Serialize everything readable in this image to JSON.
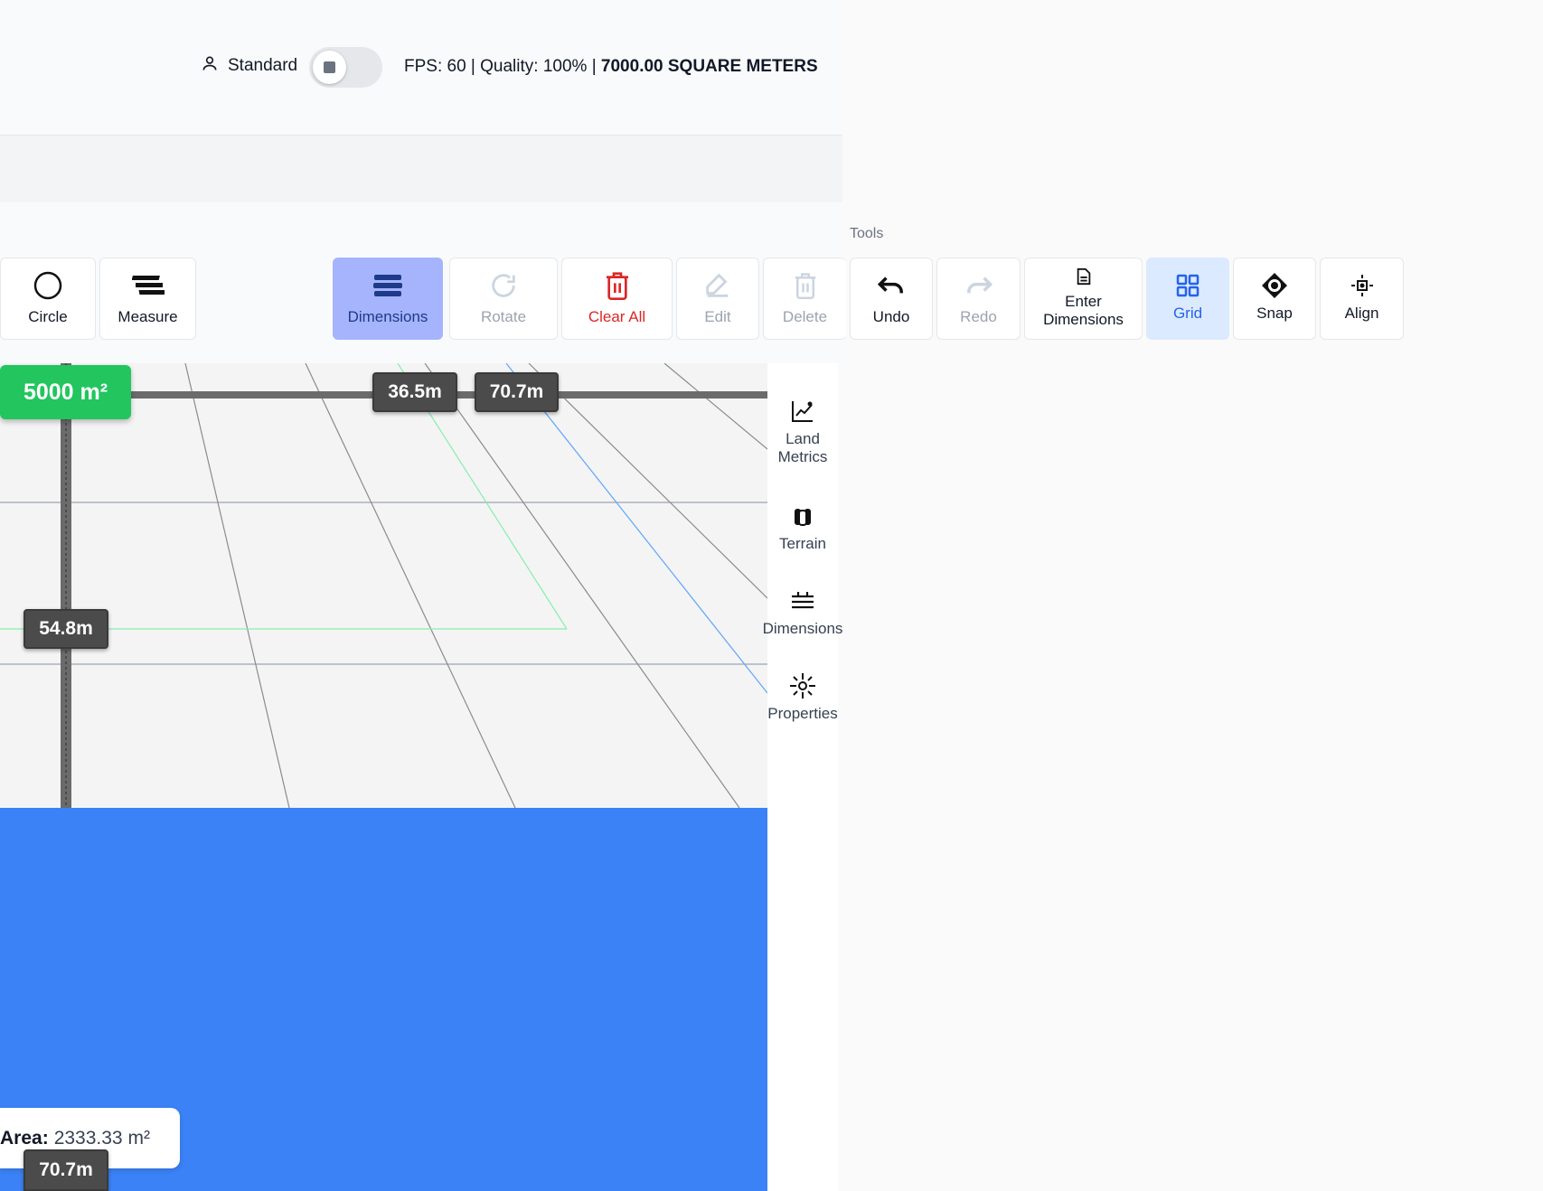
{
  "header": {
    "user_mode": "Standard",
    "status_prefix": "FPS: 60 | Quality: 100% |",
    "status_area": "7000.00 SQUARE METERS"
  },
  "tools": {
    "section_label": "Tools",
    "buttons": [
      {
        "label": "Circle",
        "icon": "circle-icon",
        "state": "normal"
      },
      {
        "label": "Measure",
        "icon": "measure-icon",
        "state": "normal"
      },
      {
        "label": "Dimensions",
        "icon": "dimensions-icon",
        "state": "active"
      },
      {
        "label": "Rotate",
        "icon": "rotate-icon",
        "state": "disabled"
      },
      {
        "label": "Clear All",
        "icon": "trash-icon",
        "state": "danger"
      },
      {
        "label": "Edit",
        "icon": "edit-icon",
        "state": "disabled"
      },
      {
        "label": "Delete",
        "icon": "trash-icon",
        "state": "disabled"
      },
      {
        "label": "Undo",
        "icon": "undo-icon",
        "state": "normal"
      },
      {
        "label": "Redo",
        "icon": "redo-icon",
        "state": "disabled"
      },
      {
        "label": "Enter Dimensions",
        "icon": "document-icon",
        "state": "normal"
      },
      {
        "label": "Grid",
        "icon": "grid-icon",
        "state": "active"
      },
      {
        "label": "Snap",
        "icon": "snap-icon",
        "state": "normal"
      },
      {
        "label": "Align",
        "icon": "align-icon",
        "state": "normal"
      }
    ]
  },
  "canvas": {
    "area_badge": "5000 m²",
    "dim_top_1": "36.5m",
    "dim_top_2": "70.7m",
    "dim_left": "54.8m",
    "dim_bottom": "70.7m"
  },
  "side_panel": {
    "items": [
      {
        "label": "Land Metrics",
        "icon": "chart-icon"
      },
      {
        "label": "Terrain",
        "icon": "terrain-icon"
      },
      {
        "label": "Dimensions",
        "icon": "dimensions-icon"
      },
      {
        "label": "Properties",
        "icon": "properties-icon"
      }
    ]
  },
  "area_card": {
    "label": "Area:",
    "value": "2333.33 m²"
  },
  "colors": {
    "accent_blue": "#3b82f6",
    "area_green": "#22c55e",
    "danger_red": "#dc2626",
    "active_purple": "#a5b4fc",
    "active_blue_bg": "#dbeafe"
  }
}
